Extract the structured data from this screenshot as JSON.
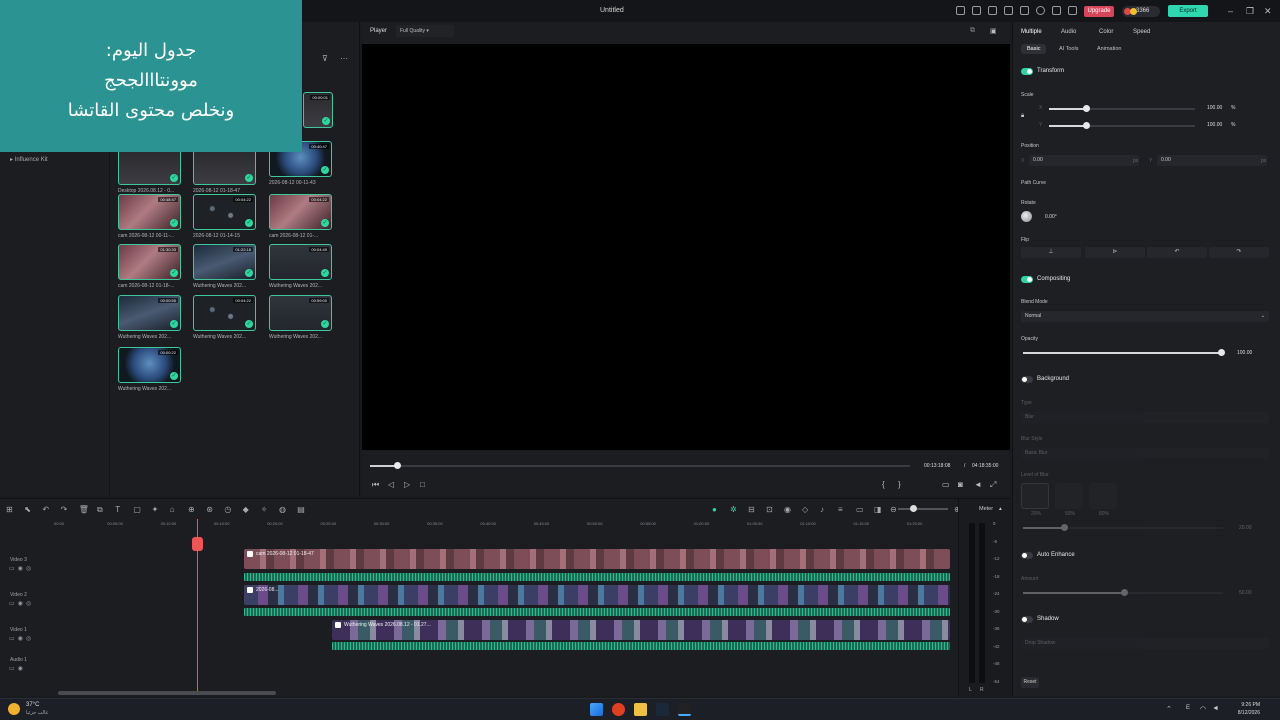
{
  "window": {
    "title": "Untitled",
    "upgrade_label": "Upgrade",
    "coins": "3366",
    "export_label": "Export"
  },
  "overlay": {
    "line1": "جدول اليوم:",
    "line2": "موونتااالجحج",
    "line3": "ونخلص محتوى القاتشا"
  },
  "media": {
    "sidebar_item": "Influence Kit",
    "thumbs": [
      {
        "label": "",
        "dur": "00:00:01",
        "bg": "bg-desk"
      },
      {
        "label": "Desktop 2026.08.12 - 0...",
        "dur": "",
        "bg": "bg-desk"
      },
      {
        "label": "2026-08-12 01-18-47",
        "dur": "",
        "bg": "bg-desk"
      },
      {
        "label": "2026-08-12 00-11-43",
        "dur": "00:40:47",
        "bg": "bg-earth"
      },
      {
        "label": "cam 2026-08-12 00-11-...",
        "dur": "00:48:47",
        "bg": "bg-cam"
      },
      {
        "label": "2026-08-12 01-14-15",
        "dur": "00:04:22",
        "bg": "bg-dots"
      },
      {
        "label": "cam 2026-08-12 01-...",
        "dur": "00:04:22",
        "bg": "bg-cam"
      },
      {
        "label": "cam 2026-08-12 01-18-...",
        "dur": "01:30:33",
        "bg": "bg-cam"
      },
      {
        "label": "Wuthering Waves 202...",
        "dur": "01:22:18",
        "bg": "bg-ww"
      },
      {
        "label": "Wuthering Waves 202...",
        "dur": "00:04:49",
        "bg": "bg-table"
      },
      {
        "label": "Wuthering Waves 202...",
        "dur": "00:00:55",
        "bg": "bg-ww"
      },
      {
        "label": "Wuthering Waves 202...",
        "dur": "00:04:22",
        "bg": "bg-dots"
      },
      {
        "label": "Wuthering Waves 202...",
        "dur": "00:59:00",
        "bg": "bg-table"
      },
      {
        "label": "Wuthering Waves 202...",
        "dur": "00:00:22",
        "bg": "bg-earth"
      }
    ]
  },
  "player": {
    "label": "Player",
    "quality": "Full Quality",
    "current_time": "00:13:18:08",
    "separator": "/",
    "total_time": "04:18:35:00",
    "progress": 0.05
  },
  "props": {
    "tabs": [
      "Multiple",
      "Audio",
      "Color",
      "Speed"
    ],
    "subtabs": [
      "Basic",
      "AI Tools",
      "Animation"
    ],
    "transform": "Transform",
    "scale": "Scale",
    "x_label": "X",
    "y_label": "Y",
    "scale_x": "100.00",
    "scale_y": "100.00",
    "pct": "%",
    "position": "Position",
    "pos_x": "0.00",
    "pos_y": "0.00",
    "px": "px",
    "path_curve": "Path Curve",
    "rotate": "Rotate",
    "rotate_val": "0.00°",
    "flip": "Flip",
    "compositing": "Compositing",
    "blend_mode": "Blend Mode",
    "blend_val": "Normal",
    "opacity": "Opacity",
    "opacity_val": "100.00",
    "background": "Background",
    "bg_type": "Type",
    "bg_type_val": "Blur",
    "bg_style": "Blur Style",
    "bg_style_val": "Basic Blur",
    "bg_level": "Level of Blur",
    "bg_level_vals": [
      "20%",
      "50%",
      "80%"
    ],
    "bg_pct": "20.00",
    "auto_enhance": "Auto Enhance",
    "amount": "Amount",
    "amount_val": "50.00",
    "shadow": "Shadow",
    "shadow_val": "Drop Shadow",
    "reset": "Reset"
  },
  "timeline": {
    "meter_label": "Meter",
    "ruler": [
      "00:00",
      "00:05:00",
      "00:10:00",
      "00:15:00",
      "00:20:00",
      "00:25:00",
      "00:30:00",
      "00:35:00",
      "00:40:00",
      "00:45:00",
      "00:50:00",
      "00:55:00",
      "01:00:00",
      "01:05:00",
      "01:10:00",
      "01:15:00",
      "01:20:00"
    ],
    "tracks": [
      "Video 3",
      "Video 2",
      "Video 1",
      "Audio 1"
    ],
    "clip_v3": "cam 2026-08-12 01-18-47",
    "clip_v2": "2026-08...",
    "clip_v1": "Wuthering Waves 2026.08.12 - 01.27...",
    "db": [
      "0",
      "-6",
      "-12",
      "-18",
      "-24",
      "-30",
      "-36",
      "-42",
      "-48",
      "-54"
    ],
    "lr": [
      "L",
      "R"
    ]
  },
  "taskbar": {
    "temp": "37°C",
    "weather": "غالب جزئيا",
    "time": "9:26 PM",
    "date": "8/12/2026",
    "lang": "E"
  },
  "colors": {
    "accent": "#2fd6a0",
    "export": "#2fd6b0",
    "upgrade": "#d6455a",
    "overlay": "#2b9493",
    "playhead": "#ee5555"
  }
}
